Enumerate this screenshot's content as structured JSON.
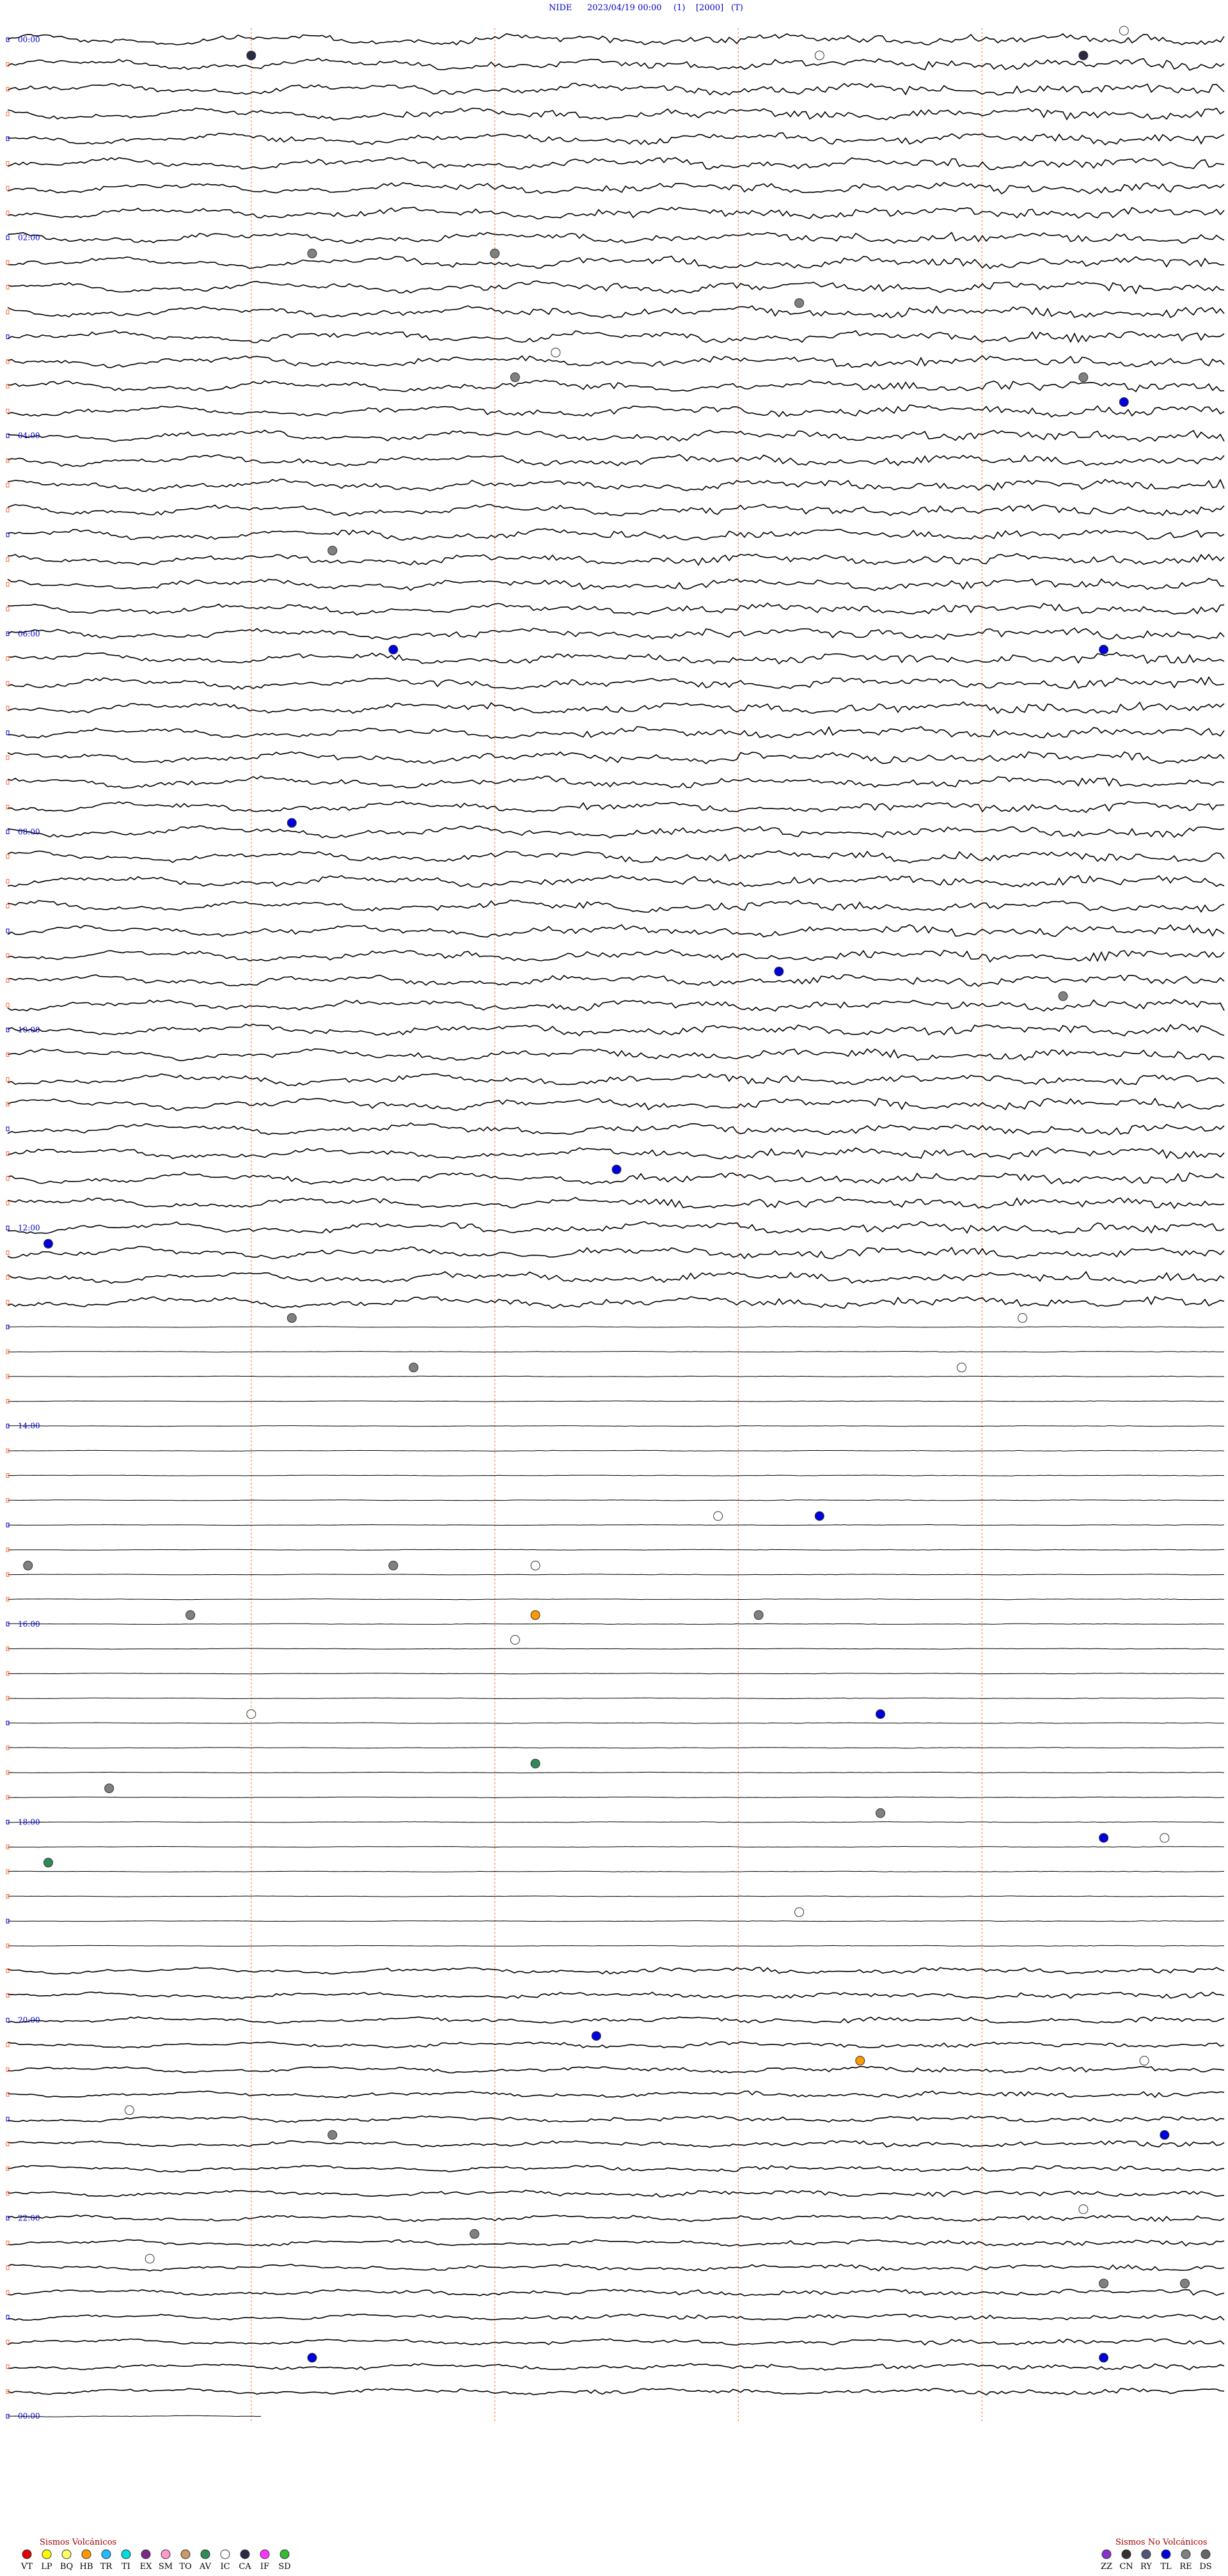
{
  "header": {
    "station": "NIDE",
    "datetime": "2023/04/19 00:00",
    "component": "(1)",
    "scale": "[2000]",
    "mode": "(T)"
  },
  "chart_data": {
    "type": "helicorder",
    "start_time": "2023/04/19 00:00",
    "traces_per_hour": 4,
    "hours_labeled": [
      "00:00",
      "02:00",
      "04:00",
      "06:00",
      "08:00",
      "10:00",
      "12:00",
      "14:00",
      "16:00",
      "18:00",
      "20:00",
      "22:00",
      "00:00"
    ],
    "amplitude_regions": [
      {
        "from_hour": 0,
        "to_hour": 12.8,
        "level": "high"
      },
      {
        "from_hour": 12.8,
        "to_hour": 19.3,
        "level": "quiet"
      },
      {
        "from_hour": 19.3,
        "to_hour": 24,
        "level": "moderate"
      }
    ],
    "events": [
      {
        "hour": 0.05,
        "minute": 55,
        "type": "IC"
      },
      {
        "hour": 0.2,
        "minute": 12,
        "type": "CA"
      },
      {
        "hour": 0.2,
        "minute": 53,
        "type": "CA"
      },
      {
        "hour": 0.2,
        "minute": 40,
        "type": "IC"
      },
      {
        "hour": 2.2,
        "minute": 15,
        "type": "RE"
      },
      {
        "hour": 2.3,
        "minute": 24,
        "type": "RE"
      },
      {
        "hour": 2.8,
        "minute": 39,
        "type": "RE"
      },
      {
        "hour": 3.2,
        "minute": 27,
        "type": "IC"
      },
      {
        "hour": 3.4,
        "minute": 53,
        "type": "RE"
      },
      {
        "hour": 3.6,
        "minute": 25,
        "type": "RE"
      },
      {
        "hour": 3.8,
        "minute": 55,
        "type": "TL"
      },
      {
        "hour": 5.2,
        "minute": 16,
        "type": "RE"
      },
      {
        "hour": 6.3,
        "minute": 19,
        "type": "TL"
      },
      {
        "hour": 6.35,
        "minute": 54,
        "type": "TL"
      },
      {
        "hour": 8.0,
        "minute": 14,
        "type": "TL"
      },
      {
        "hour": 9.6,
        "minute": 38,
        "type": "TL"
      },
      {
        "hour": 9.8,
        "minute": 52,
        "type": "RE"
      },
      {
        "hour": 11.5,
        "minute": 30,
        "type": "TL"
      },
      {
        "hour": 12.3,
        "minute": 2,
        "type": "TL"
      },
      {
        "hour": 13.0,
        "minute": 50,
        "type": "IC"
      },
      {
        "hour": 13.0,
        "minute": 14,
        "type": "RE"
      },
      {
        "hour": 13.5,
        "minute": 20,
        "type": "RE"
      },
      {
        "hour": 13.5,
        "minute": 47,
        "type": "IC"
      },
      {
        "hour": 15.0,
        "minute": 35,
        "type": "IC"
      },
      {
        "hour": 15.0,
        "minute": 40,
        "type": "TL"
      },
      {
        "hour": 15.5,
        "minute": 19,
        "type": "RE"
      },
      {
        "hour": 15.6,
        "minute": 1,
        "type": "RE"
      },
      {
        "hour": 15.6,
        "minute": 26,
        "type": "IC"
      },
      {
        "hour": 16.0,
        "minute": 9,
        "type": "RE"
      },
      {
        "hour": 16.0,
        "minute": 37,
        "type": "RE"
      },
      {
        "hour": 16.1,
        "minute": 26,
        "type": "HB"
      },
      {
        "hour": 16.2,
        "minute": 25,
        "type": "IC"
      },
      {
        "hour": 17.0,
        "minute": 12,
        "type": "IC"
      },
      {
        "hour": 17.0,
        "minute": 43,
        "type": "TL"
      },
      {
        "hour": 17.5,
        "minute": 26,
        "type": "AV"
      },
      {
        "hour": 17.7,
        "minute": 5,
        "type": "RE"
      },
      {
        "hour": 17.9,
        "minute": 43,
        "type": "RE"
      },
      {
        "hour": 18.2,
        "minute": 54,
        "type": "TL"
      },
      {
        "hour": 18.2,
        "minute": 57,
        "type": "IC"
      },
      {
        "hour": 18.6,
        "minute": 2,
        "type": "AV"
      },
      {
        "hour": 19.0,
        "minute": 39,
        "type": "IC"
      },
      {
        "hour": 20.3,
        "minute": 29,
        "type": "TL"
      },
      {
        "hour": 20.5,
        "minute": 42,
        "type": "HB"
      },
      {
        "hour": 20.4,
        "minute": 56,
        "type": "IC"
      },
      {
        "hour": 20.9,
        "minute": 6,
        "type": "IC"
      },
      {
        "hour": 21.2,
        "minute": 16,
        "type": "RE"
      },
      {
        "hour": 21.2,
        "minute": 57,
        "type": "TL"
      },
      {
        "hour": 22.0,
        "minute": 53,
        "type": "IC"
      },
      {
        "hour": 22.3,
        "minute": 23,
        "type": "RE"
      },
      {
        "hour": 22.4,
        "minute": 7,
        "type": "IC"
      },
      {
        "hour": 22.7,
        "minute": 54,
        "type": "RE"
      },
      {
        "hour": 22.8,
        "minute": 58,
        "type": "RE"
      },
      {
        "hour": 23.4,
        "minute": 15,
        "type": "TL"
      },
      {
        "hour": 23.6,
        "minute": 54,
        "type": "TL"
      }
    ]
  },
  "legend_volcanic": {
    "title": "Sismos Volcánicos",
    "items": [
      {
        "code": "VT",
        "color": "#e00000"
      },
      {
        "code": "LP",
        "color": "#ffff00"
      },
      {
        "code": "BQ",
        "color": "#ffff66"
      },
      {
        "code": "HB",
        "color": "#ff9900"
      },
      {
        "code": "TR",
        "color": "#22bbff"
      },
      {
        "code": "TI",
        "color": "#00dddd"
      },
      {
        "code": "EX",
        "color": "#7b2a88"
      },
      {
        "code": "SM",
        "color": "#ff99cc"
      },
      {
        "code": "TO",
        "color": "#cc9966"
      },
      {
        "code": "AV",
        "color": "#2e8b57"
      },
      {
        "code": "IC",
        "color": "#ffffff"
      },
      {
        "code": "CA",
        "color": "#2a2a44"
      },
      {
        "code": "IF",
        "color": "#ff33ff"
      },
      {
        "code": "SD",
        "color": "#33bb33"
      }
    ]
  },
  "legend_nonvolcanic": {
    "title": "Sismos No Volcánicos",
    "items": [
      {
        "code": "ZZ",
        "color": "#8833cc"
      },
      {
        "code": "CN",
        "color": "#333333"
      },
      {
        "code": "RY",
        "color": "#555577"
      },
      {
        "code": "TL",
        "color": "#0000dd"
      },
      {
        "code": "RE",
        "color": "#808080"
      },
      {
        "code": "DS",
        "color": "#666666"
      }
    ]
  }
}
